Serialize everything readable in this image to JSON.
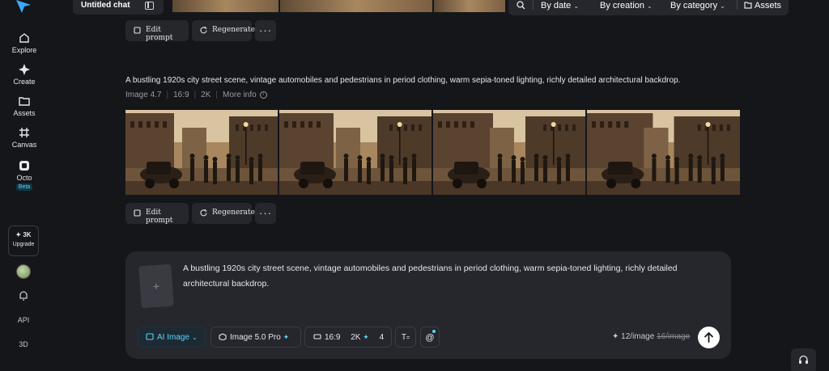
{
  "sidebar": {
    "items": [
      {
        "label": "Explore",
        "icon": "home-icon"
      },
      {
        "label": "Create",
        "icon": "sparkle-icon"
      },
      {
        "label": "Assets",
        "icon": "folder-icon"
      },
      {
        "label": "Canvas",
        "icon": "canvas-icon"
      },
      {
        "label": "Octo",
        "icon": "octo-icon",
        "badge": "Beta"
      }
    ],
    "upgrade": {
      "credits": "✦ 3K",
      "label": "Upgrade"
    },
    "api_label": "API",
    "threed_label": "3D"
  },
  "header": {
    "chat_title": "Untitled chat",
    "filters": {
      "by_date": "By date",
      "by_creation": "By creation",
      "by_category": "By category",
      "assets": "Assets"
    }
  },
  "actions": {
    "edit_prompt": "Edit prompt",
    "regenerate": "Regenerate",
    "more": "···"
  },
  "generation": {
    "prompt": "A bustling 1920s city street scene, vintage automobiles and pedestrians in period clothing, warm sepia-toned lighting, richly detailed architectural backdrop.",
    "model": "Image 4.7",
    "aspect": "16:9",
    "resolution": "2K",
    "more_info": "More info",
    "image_count": 4
  },
  "composer": {
    "text": "A bustling 1920s city street scene, vintage automobiles and pedestrians in period clothing, warm sepia-toned lighting, richly detailed architectural backdrop.",
    "ai_image": "AI Image",
    "model": "Image 5.0 Pro",
    "aspect": "16:9",
    "resolution": "2K",
    "count": "4",
    "cost_new": "12/image",
    "cost_old": "16/image"
  },
  "colors": {
    "accent": "#5ad2ff",
    "background": "#15161a",
    "panel": "#26272d"
  }
}
